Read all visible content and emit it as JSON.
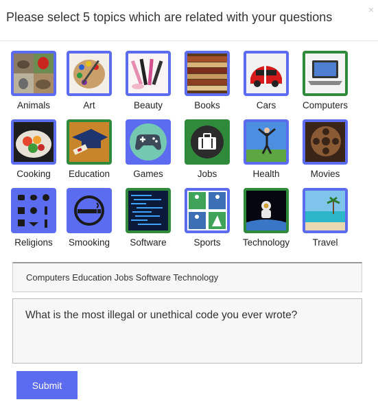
{
  "dialog": {
    "title": "Please select 5 topics which are related with your questions",
    "close_label": "×"
  },
  "topics": [
    {
      "label": "Animals",
      "selected": false,
      "icon": "animals-collage-icon"
    },
    {
      "label": "Art",
      "selected": false,
      "icon": "paint-palette-icon"
    },
    {
      "label": "Beauty",
      "selected": false,
      "icon": "makeup-brushes-icon"
    },
    {
      "label": "Books",
      "selected": false,
      "icon": "books-stack-icon"
    },
    {
      "label": "Cars",
      "selected": false,
      "icon": "red-car-icon"
    },
    {
      "label": "Computers",
      "selected": true,
      "icon": "laptop-icon"
    },
    {
      "label": "Cooking",
      "selected": false,
      "icon": "food-plate-icon"
    },
    {
      "label": "Education",
      "selected": true,
      "icon": "graduation-cap-icon"
    },
    {
      "label": "Games",
      "selected": false,
      "icon": "gamepad-icon"
    },
    {
      "label": "Jobs",
      "selected": true,
      "icon": "briefcase-icon"
    },
    {
      "label": "Health",
      "selected": false,
      "icon": "yoga-pose-icon"
    },
    {
      "label": "Movies",
      "selected": false,
      "icon": "film-reel-icon"
    },
    {
      "label": "Religions",
      "selected": false,
      "icon": "religious-symbols-icon"
    },
    {
      "label": "Smooking",
      "selected": false,
      "icon": "cigarette-icon"
    },
    {
      "label": "Software",
      "selected": true,
      "icon": "code-screen-icon"
    },
    {
      "label": "Sports",
      "selected": false,
      "icon": "sports-pictograms-icon"
    },
    {
      "label": "Technology",
      "selected": true,
      "icon": "astronaut-icon"
    },
    {
      "label": "Travel",
      "selected": false,
      "icon": "beach-resort-icon"
    }
  ],
  "selected_topics_text": "Computers Education Jobs Software Technology",
  "question_text": "What is the most illegal or unethical code you ever wrote?",
  "submit_label": "Submit",
  "colors": {
    "accent": "#5b6cf0",
    "selected_border": "#2f8a3c"
  }
}
